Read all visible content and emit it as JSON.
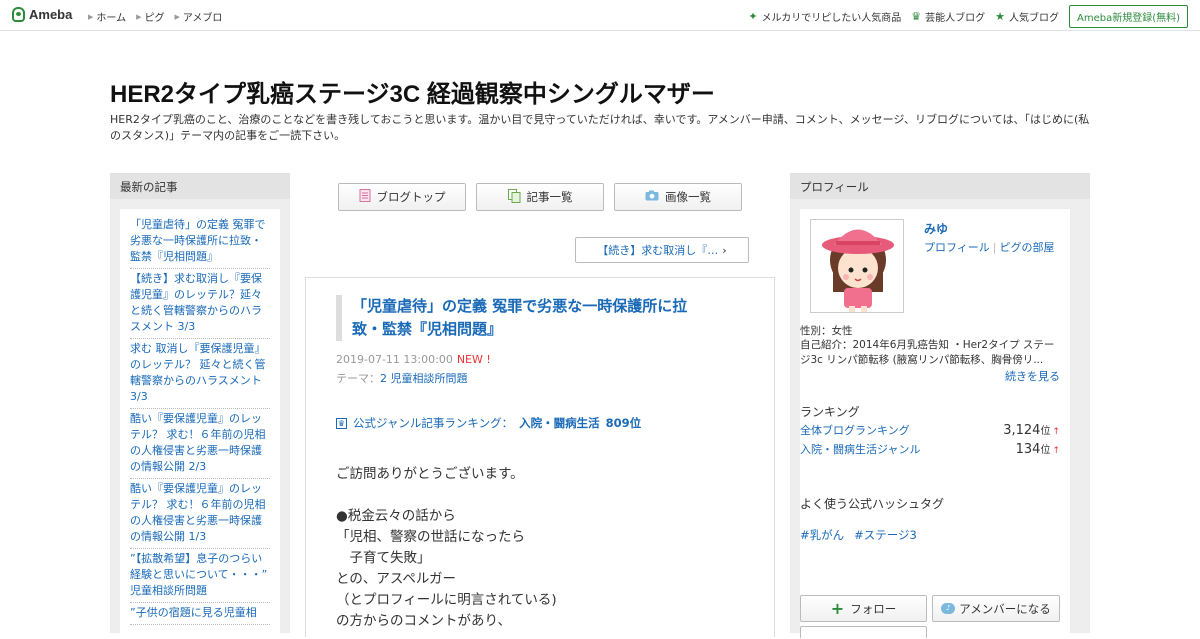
{
  "topbar": {
    "logo_text": "Ameba",
    "nav": [
      "ホーム",
      "ピグ",
      "アメブロ"
    ],
    "right_links": [
      {
        "label": "メルカリでリピしたい人気商品",
        "icon": "sparkle-icon"
      },
      {
        "label": "芸能人ブログ",
        "icon": "crown-icon"
      },
      {
        "label": "人気ブログ",
        "icon": "star-icon"
      }
    ],
    "signup_label": "Ameba新規登録(無料)"
  },
  "blog": {
    "title": "HER2タイプ乳癌ステージ3C 経過観察中シングルマザー",
    "description": "HER2タイプ乳癌のこと、治療のことなどを書き残しておこうと思います。温かい目で見守っていただければ、幸いです。アメンバー申請、コメント、メッセージ、リブログについては、「はじめに(私のスタンス)」テーマ内の記事をご一読下さい。"
  },
  "recent": {
    "heading": "最新の記事",
    "items": [
      "「児童虐待」の定義 冤罪で劣悪な一時保護所に拉致・監禁『児相問題』",
      "【続き】求む取消し『要保護児童』のレッテル？延々と続く管轄警察からのハラスメント 3/3",
      "求む 取消し『要保護児童』のレッテル？ 延々と続く管轄警察からのハラスメント 3/3",
      "酷い『要保護児童』のレッテル？ 求む！６年前の児相の人権侵害と劣悪一時保護の情報公開 2/3",
      "酷い『要保護児童』のレッテル？ 求む！６年前の児相の人権侵害と劣悪一時保護の情報公開 1/3",
      "”【拡散希望】息子のつらい経験と思いについて・・・” 児童相談所問題",
      "”子供の宿題に見る児童相"
    ]
  },
  "tabs": [
    {
      "label": "ブログトップ",
      "icon": "document-icon"
    },
    {
      "label": "記事一覧",
      "icon": "copy-icon"
    },
    {
      "label": "画像一覧",
      "icon": "camera-icon"
    }
  ],
  "next_link": "【続き】求む取消し『…",
  "article": {
    "title": "「児童虐待」の定義 冤罪で劣悪な一時保護所に拉致・監禁『児相問題』",
    "date": "2019-07-11 13:00:00",
    "new_label": "NEW !",
    "theme_prefix": "テーマ：",
    "theme": "2 児童相談所問題",
    "ranking_prefix": "公式ジャンル記事ランキング：",
    "ranking_genre": "入院・闘病生活",
    "ranking_rank": "809位",
    "body": "ご訪問ありがとうございます。\n\n●税金云々の話から\n「児相、警察の世話になったら\n　子育て失敗」\nとの、アスペルガー\n（とプロフィールに明言されている)\nの方からのコメントがあり、"
  },
  "profile": {
    "heading": "プロフィール",
    "name": "みゆ",
    "link_profile": "プロフィール",
    "link_pig": "ピグの部屋",
    "gender": "性別：女性",
    "intro": "自己紹介：2014年6月乳癌告知 ・Her2タイプ ステージ3c リンパ節転移 (腋窩リンパ節転移、胸骨傍リ...",
    "more": "続きを見る",
    "ranking_heading": "ランキング",
    "rankings": [
      {
        "label": "全体ブログランキング",
        "value": "3,124",
        "unit": "位",
        "arrow": "↑"
      },
      {
        "label": "入院・闘病生活ジャンル",
        "value": "134",
        "unit": "位",
        "arrow": "↑"
      }
    ],
    "hashtag_heading": "よく使う公式ハッシュタグ",
    "hashtags": [
      "#乳がん",
      "#ステージ3"
    ],
    "follow_label": "フォロー",
    "amember_label": "アメンバーになる"
  }
}
